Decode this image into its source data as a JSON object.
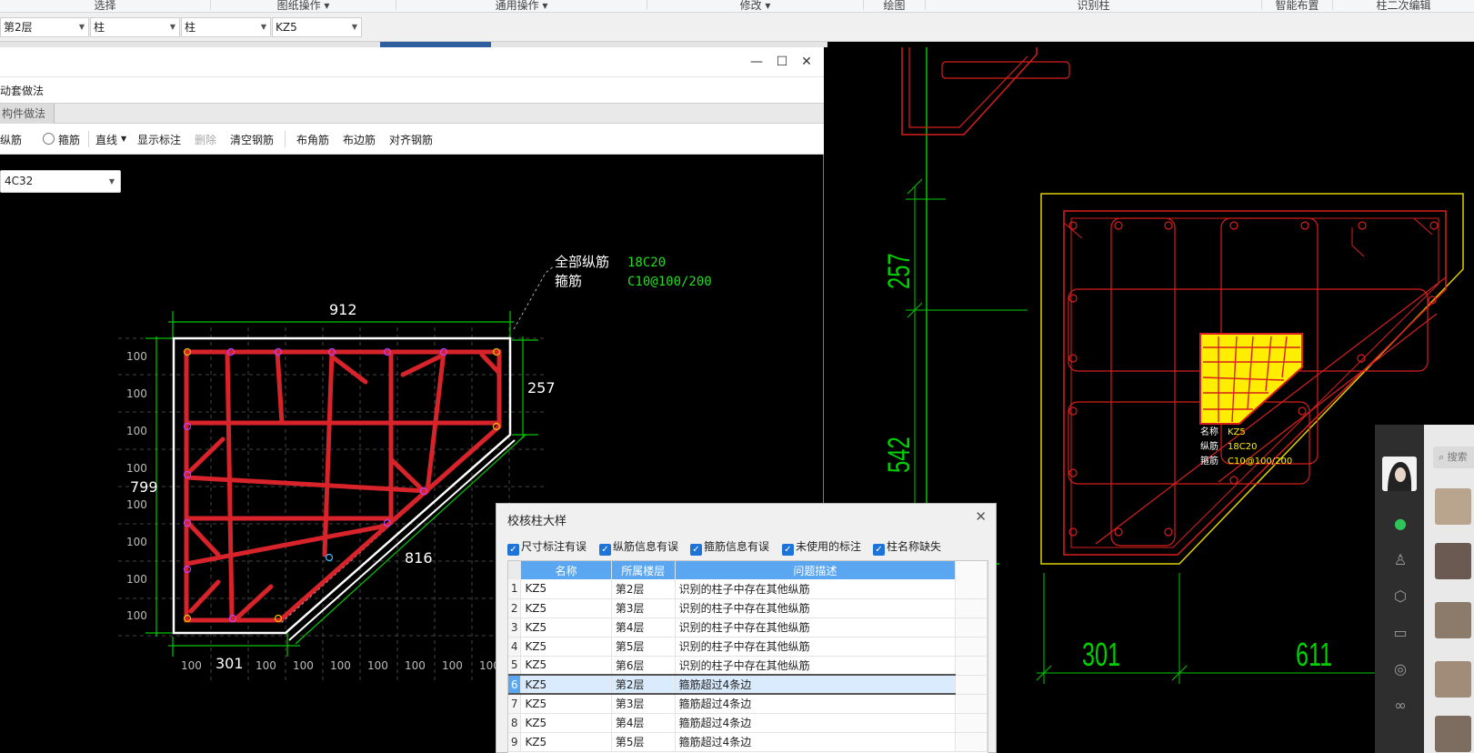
{
  "ribbon": {
    "groups": [
      "选择",
      "图纸操作 ▾",
      "通用操作 ▾",
      "修改 ▾",
      "绘图",
      "识别柱",
      "智能布置",
      "柱二次编辑"
    ]
  },
  "selector": {
    "floor": "第2层",
    "type": "柱",
    "subtype": "柱",
    "component": "KZ5"
  },
  "window": {
    "buttons": [
      "—",
      "☐",
      "✕"
    ],
    "method_title": "动套做法",
    "tab": "构件做法",
    "toolbar": {
      "longitudinal": "纵筋",
      "stirrup": "箍筋",
      "line": "直线",
      "show_label": "显示标注",
      "delete": "删除",
      "clear": "清空钢筋",
      "corner": "布角筋",
      "edge": "布边筋",
      "align": "对齐钢筋"
    },
    "rebar_value": "4C32"
  },
  "drawing_left": {
    "label_all_long": "全部纵筋",
    "label_all_long_value": "18C20",
    "label_stirrup": "箍筋",
    "label_stirrup_value": "C10@100/200",
    "dim_top": "912",
    "dim_right": "257",
    "dim_left": "799",
    "dim_diag": "816",
    "dim_bottom": "301",
    "grid_step": "100"
  },
  "drawing_right": {
    "dim_257": "257",
    "dim_542": "542",
    "dim_301": "301",
    "dim_611": "611",
    "tag_name_label": "名称",
    "tag_name": "KZ5",
    "tag_long_label": "纵筋",
    "tag_long": "18C20",
    "tag_stirrup_label": "箍筋",
    "tag_stirrup": "C10@100/200"
  },
  "check_dialog": {
    "title": "校核柱大样",
    "close": "✕",
    "options": [
      "尺寸标注有误",
      "纵筋信息有误",
      "箍筋信息有误",
      "未使用的标注",
      "柱名称缺失"
    ],
    "columns": [
      "名称",
      "所属楼层",
      "问题描述"
    ],
    "rows": [
      {
        "n": "1",
        "name": "KZ5",
        "floor": "第2层",
        "desc": "识别的柱子中存在其他纵筋"
      },
      {
        "n": "2",
        "name": "KZ5",
        "floor": "第3层",
        "desc": "识别的柱子中存在其他纵筋"
      },
      {
        "n": "3",
        "name": "KZ5",
        "floor": "第4层",
        "desc": "识别的柱子中存在其他纵筋"
      },
      {
        "n": "4",
        "name": "KZ5",
        "floor": "第5层",
        "desc": "识别的柱子中存在其他纵筋"
      },
      {
        "n": "5",
        "name": "KZ5",
        "floor": "第6层",
        "desc": "识别的柱子中存在其他纵筋"
      },
      {
        "n": "6",
        "name": "KZ5",
        "floor": "第2层",
        "desc": "箍筋超过4条边"
      },
      {
        "n": "7",
        "name": "KZ5",
        "floor": "第3层",
        "desc": "箍筋超过4条边"
      },
      {
        "n": "8",
        "name": "KZ5",
        "floor": "第4层",
        "desc": "箍筋超过4条边"
      },
      {
        "n": "9",
        "name": "KZ5",
        "floor": "第5层",
        "desc": "箍筋超过4条边"
      }
    ],
    "selected_row": "6"
  },
  "chat": {
    "search_placeholder": "搜索"
  },
  "colors": {
    "rebar_red": "#d8232a",
    "dim_green": "#00d000",
    "select_yellow": "#ffee00",
    "row_blue": "#5aa6f0"
  }
}
